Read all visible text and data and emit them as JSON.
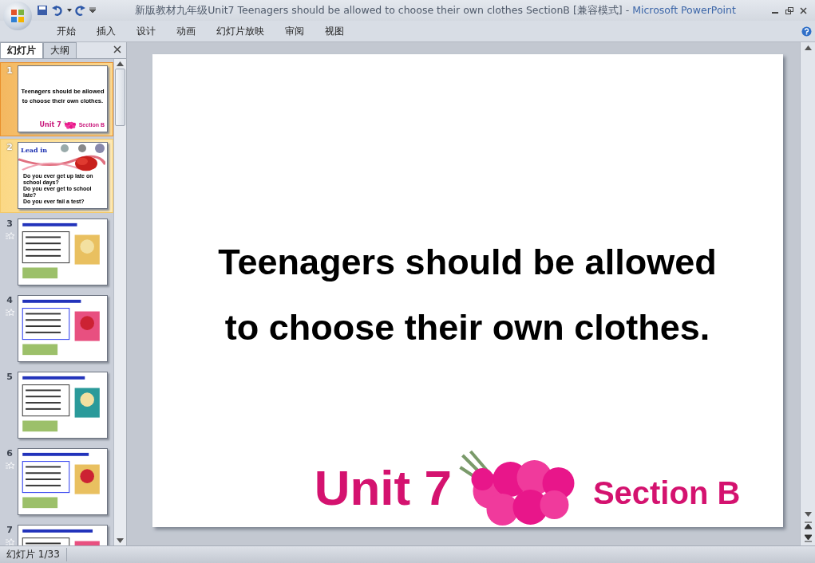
{
  "window": {
    "title": "新版教材九年级Unit7 Teenagers should be allowed to choose their own clothes SectionB [兼容模式]",
    "separator": "-",
    "app": "Microsoft PowerPoint"
  },
  "ribbon_tabs": [
    "开始",
    "插入",
    "设计",
    "动画",
    "幻灯片放映",
    "审阅",
    "视图"
  ],
  "panel_tabs": [
    {
      "label": "幻灯片",
      "selected": true
    },
    {
      "label": "大纲",
      "selected": false
    }
  ],
  "slides": [
    {
      "number": "1",
      "selected": true,
      "hovered": false,
      "animated": false,
      "kind": "title",
      "lines": [
        "Teenagers should be allowed",
        "to choose their own clothes."
      ],
      "unit": "Unit 7",
      "section": "Section B"
    },
    {
      "number": "2",
      "selected": false,
      "hovered": true,
      "animated": false,
      "kind": "lead_in",
      "heading": "Lead in",
      "lines": [
        "Do you ever get up late on school days?",
        "Do you ever get to school late?",
        "Do you ever fail a test?"
      ]
    },
    {
      "number": "3",
      "selected": false,
      "hovered": false,
      "animated": true,
      "kind": "sketch"
    },
    {
      "number": "4",
      "selected": false,
      "hovered": false,
      "animated": true,
      "kind": "sketch"
    },
    {
      "number": "5",
      "selected": false,
      "hovered": false,
      "animated": false,
      "kind": "sketch"
    },
    {
      "number": "6",
      "selected": false,
      "hovered": false,
      "animated": true,
      "kind": "sketch"
    },
    {
      "number": "7",
      "selected": false,
      "hovered": false,
      "animated": true,
      "kind": "sketch"
    }
  ],
  "slide": {
    "lines": [
      "Teenagers should be allowed",
      "to choose their own clothes."
    ],
    "unit": "Unit 7",
    "section": "Section B"
  },
  "status_bar": {
    "slide_counter": "幻灯片 1/33"
  }
}
